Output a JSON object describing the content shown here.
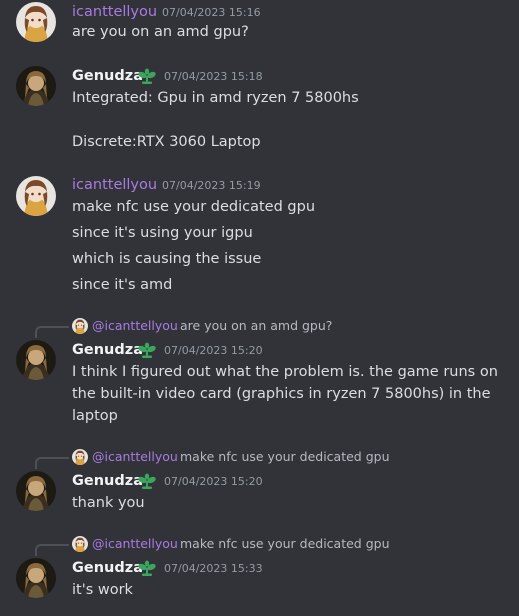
{
  "users": {
    "a": "icanttellyou",
    "b": "Genudza"
  },
  "icons": {
    "badge": "sprout-badge-icon"
  },
  "colors": {
    "background": "#313338",
    "username_a": "#a97be0",
    "badge": "#3ba55d"
  },
  "messages": [
    {
      "author": "icanttellyou",
      "time": "07/04/2023 15:16",
      "lines": [
        "are you on an amd gpu?"
      ]
    },
    {
      "author": "Genudza",
      "time": "07/04/2023 15:18",
      "lines": [
        "Integrated: Gpu in amd ryzen 7 5800hs",
        "Discrete:RTX 3060 Laptop"
      ]
    },
    {
      "author": "icanttellyou",
      "time": "07/04/2023 15:19",
      "lines": [
        "make nfc use your dedicated gpu",
        "since it's using your igpu",
        "which is causing the issue",
        "since it's amd"
      ]
    },
    {
      "author": "Genudza",
      "time": "07/04/2023 15:20",
      "reply": {
        "name": "@icanttellyou",
        "text": "are you on an amd gpu?"
      },
      "lines": [
        "I think I figured out what the problem is. the game runs on",
        "the built-in video card (graphics in ryzen 7 5800hs) in the",
        "laptop"
      ]
    },
    {
      "author": "Genudza",
      "time": "07/04/2023 15:20",
      "reply": {
        "name": "@icanttellyou",
        "text": "make nfc use your dedicated gpu"
      },
      "lines": [
        "thank you"
      ]
    },
    {
      "author": "Genudza",
      "time": "07/04/2023 15:33",
      "reply": {
        "name": "@icanttellyou",
        "text": "make nfc use your dedicated gpu"
      },
      "lines": [
        "it's work"
      ]
    }
  ]
}
